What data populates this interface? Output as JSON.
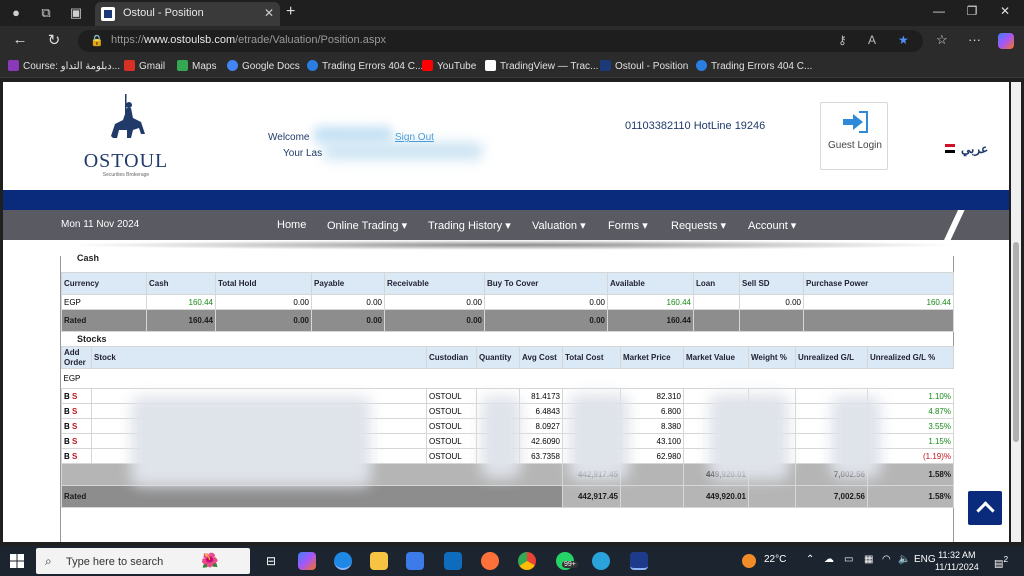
{
  "browser": {
    "tab_title": "Ostoul - Position",
    "url_prefix": "https://",
    "url_domain": "www.ostoulsb.com",
    "url_path": "/etrade/Valuation/Position.aspx",
    "bookmarks": [
      {
        "label": "Course: دبلومة التداو...",
        "color": "#8a3ab9"
      },
      {
        "label": "Gmail",
        "color": "#d93025"
      },
      {
        "label": "Maps",
        "color": "#34a853"
      },
      {
        "label": "Google Docs",
        "color": "#4285f4"
      },
      {
        "label": "Trading Errors 404 C...",
        "color": "#2a7de1"
      },
      {
        "label": "YouTube",
        "color": "#ff0000"
      },
      {
        "label": "TradingView — Trac...",
        "color": "#ffffff"
      },
      {
        "label": "Ostoul - Position",
        "color": "#1a3a7a"
      },
      {
        "label": "Trading Errors 404 C...",
        "color": "#2a7de1"
      }
    ]
  },
  "header": {
    "logo_name": "OSTOUL",
    "logo_sub": "Securities Brokerage",
    "welcome_label": "Welcome",
    "last_login_label": "Your Las",
    "signout_label": "Sign Out",
    "hotline": "01103382110 HotLine 19246",
    "guest_login": "Guest Login",
    "language": "عربي"
  },
  "menu": {
    "date": "Mon 11 Nov 2024",
    "items": [
      "Home",
      "Online Trading ▾",
      "Trading History ▾",
      "Valuation ▾",
      "Forms ▾",
      "Requests ▾",
      "Account ▾"
    ]
  },
  "cash": {
    "title": "Cash",
    "headers": [
      "Currency",
      "Cash",
      "Total Hold",
      "Payable",
      "Receivable",
      "Buy To Cover",
      "Available",
      "Loan",
      "Sell SD",
      "Purchase Power"
    ],
    "row": [
      "EGP",
      "160.44",
      "0.00",
      "0.00",
      "0.00",
      "0.00",
      "160.44",
      "",
      "0.00",
      "160.44"
    ],
    "rated": [
      "Rated",
      "160.44",
      "0.00",
      "0.00",
      "0.00",
      "0.00",
      "160.44",
      "",
      "",
      ""
    ]
  },
  "stocks": {
    "title": "Stocks",
    "headers": [
      "Add Order",
      "Stock",
      "Custodian",
      "Quantity",
      "Avg Cost",
      "Total Cost",
      "Market Price",
      "Market Value",
      "Weight %",
      "Unrealized G/L",
      "Unrealized G/L %"
    ],
    "group": "EGP",
    "rows": [
      {
        "b": "B",
        "s": "S",
        "custodian": "OSTOUL",
        "avg_cost": "81.4173",
        "market_price": "82.310",
        "gl_pct": "1.10%",
        "neg": false
      },
      {
        "b": "B",
        "s": "S",
        "custodian": "OSTOUL",
        "avg_cost": "6.4843",
        "market_price": "6.800",
        "gl_pct": "4.87%",
        "neg": false
      },
      {
        "b": "B",
        "s": "S",
        "custodian": "OSTOUL",
        "avg_cost": "8.0927",
        "market_price": "8.380",
        "gl_pct": "3.55%",
        "neg": false
      },
      {
        "b": "B",
        "s": "S",
        "custodian": "OSTOUL",
        "avg_cost": "42.6090",
        "market_price": "43.100",
        "gl_pct": "1.15%",
        "neg": false
      },
      {
        "b": "B",
        "s": "S",
        "custodian": "OSTOUL",
        "avg_cost": "63.7358",
        "market_price": "62.980",
        "gl_pct": "(1.19)%",
        "neg": true
      }
    ],
    "total": {
      "total_cost": "442,917.45",
      "market_value": "449,920.01",
      "gl": "7,002.56",
      "gl_pct": "1.58%"
    },
    "rated": {
      "label": "Rated",
      "total_cost": "442,917.45",
      "market_value": "449,920.01",
      "gl": "7,002.56",
      "gl_pct": "1.58%"
    }
  },
  "taskbar": {
    "search_placeholder": "Type here to search",
    "badge": "99+",
    "weather": "22°C",
    "lang": "ENG",
    "time": "11:32 AM",
    "date": "11/11/2024",
    "notif_count": "2"
  }
}
